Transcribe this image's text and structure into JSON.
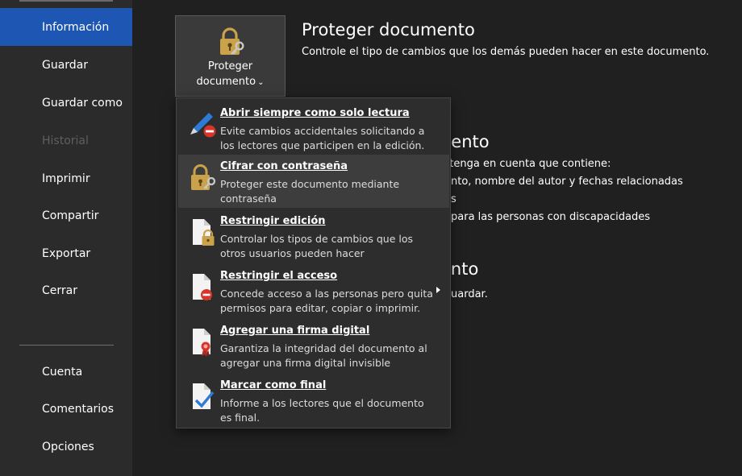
{
  "sidebar": {
    "items": [
      {
        "label": "Información"
      },
      {
        "label": "Guardar"
      },
      {
        "label": "Guardar como"
      },
      {
        "label": "Historial"
      },
      {
        "label": "Imprimir"
      },
      {
        "label": "Compartir"
      },
      {
        "label": "Exportar"
      },
      {
        "label": "Cerrar"
      },
      {
        "label": "Cuenta"
      },
      {
        "label": "Comentarios"
      },
      {
        "label": "Opciones"
      }
    ]
  },
  "protect_button": {
    "line1": "Proteger",
    "line2": "documento",
    "chevron": "⌄"
  },
  "protect_section": {
    "title": "Proteger documento",
    "description": "Controle el tipo de cambios que los demás pueden hacer en este documento."
  },
  "inspect_section": {
    "title_fragment": "nento",
    "line1": ", tenga en cuenta que contiene:",
    "line2": "nto, nombre del autor y fechas relacionadas",
    "line3": "s",
    "line4": "para las personas con discapacidades"
  },
  "manage_section": {
    "title_fragment": "ento",
    "line1": "uardar."
  },
  "menu": {
    "items": [
      {
        "title": "Abrir siempre como solo lectura",
        "desc": "Evite cambios accidentales solicitando a\nlos lectores que participen en la edición."
      },
      {
        "title": "Cifrar con contraseña",
        "desc": "Proteger este documento mediante\ncontraseña"
      },
      {
        "title": "Restringir edición",
        "desc": "Controlar los tipos de cambios que los\notros usuarios pueden hacer"
      },
      {
        "title": "Restringir el acceso",
        "desc": "Concede acceso a las personas pero quita\npermisos para editar, copiar o imprimir."
      },
      {
        "title": "Agregar una firma digital",
        "desc": "Garantiza la integridad del documento al\nagregar una firma digital invisible"
      },
      {
        "title": "Marcar como final",
        "desc": "Informe a los lectores que el documento\nes final."
      }
    ]
  },
  "colors": {
    "accent": "#1e56b4",
    "lock": "#c9a24a",
    "prohibit": "#d9342b"
  }
}
